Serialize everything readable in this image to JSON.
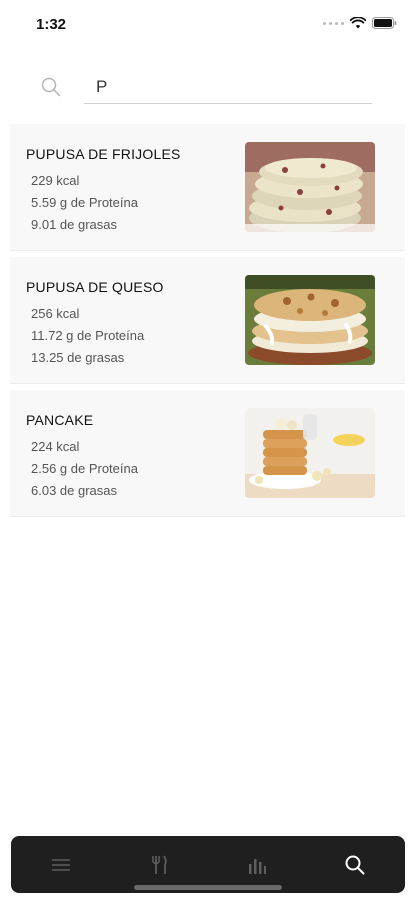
{
  "status": {
    "time": "1:32"
  },
  "search": {
    "query": "P"
  },
  "foods": [
    {
      "name": "PUPUSA DE FRIJOLES",
      "kcal": "229 kcal",
      "protein": "5.59 g de Proteína",
      "fat": "9.01 de grasas"
    },
    {
      "name": "PUPUSA DE QUESO",
      "kcal": "256 kcal",
      "protein": "11.72 g de Proteína",
      "fat": "13.25 de grasas"
    },
    {
      "name": "PANCAKE",
      "kcal": "224 kcal",
      "protein": "2.56 g de Proteína",
      "fat": "6.03 de grasas"
    }
  ],
  "tabs": [
    {
      "icon": "menu-icon",
      "active": false
    },
    {
      "icon": "utensils-icon",
      "active": false
    },
    {
      "icon": "stats-icon",
      "active": false
    },
    {
      "icon": "search-icon",
      "active": true
    }
  ]
}
